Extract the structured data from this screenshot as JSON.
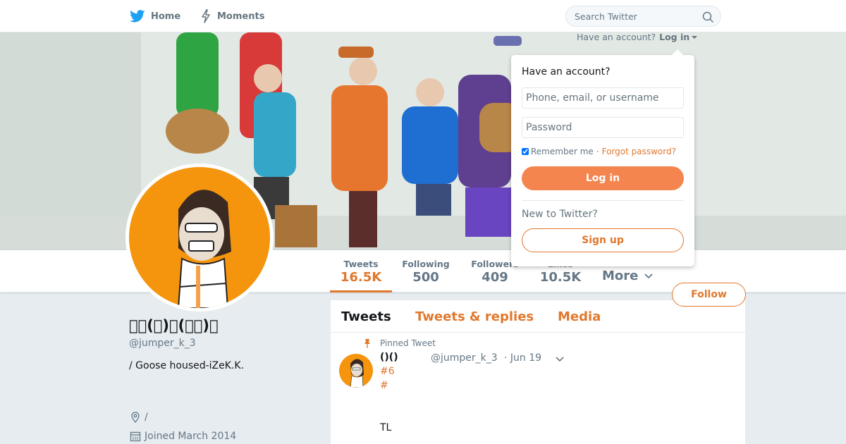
{
  "nav": {
    "home_label": "Home",
    "moments_label": "Moments",
    "search_placeholder": "Search Twitter"
  },
  "login_prompt": {
    "have_account": "Have an account?",
    "login_link": "Log in"
  },
  "login_dropdown": {
    "title": "Have an account?",
    "username_placeholder": "Phone, email, or username",
    "password_placeholder": "Password",
    "remember_label": "Remember me",
    "separator": "·",
    "forgot_label": "Forgot password?",
    "login_button": "Log in",
    "new_label": "New to Twitter?",
    "signup_button": "Sign up"
  },
  "stats": [
    {
      "label": "Tweets",
      "value": "16.5K"
    },
    {
      "label": "Following",
      "value": "500"
    },
    {
      "label": "Followers",
      "value": "409"
    },
    {
      "label": "Likes",
      "value": "10.5K"
    }
  ],
  "more_label": "More",
  "follow_button": "Follow",
  "profile": {
    "name": "\u0000\u0000(\u0000)\u0000(\u0000\u0000)\u0000",
    "handle": "@jumper_k_3",
    "bio": "/ Goose housed-iZeK.K.",
    "location": "/",
    "joined": "Joined March 2014"
  },
  "timeline": {
    "tabs": [
      "Tweets",
      "Tweets & replies",
      "Media"
    ],
    "pinned_label": "Pinned Tweet",
    "tweet": {
      "name": "()()",
      "handle": "@jumper_k_3",
      "date": "· Jun 19",
      "hashtag1": "#6",
      "hashtag2": "#",
      "text": "TL"
    }
  },
  "colors": {
    "accent": "#e0782d",
    "button_fill": "#f5854f",
    "avatar_bg": "#f5950e",
    "page_bg": "#e6ecf0"
  },
  "icons": [
    "twitter-bird-icon",
    "moments-bolt-icon",
    "search-icon",
    "chevron-down-icon",
    "pin-icon",
    "location-icon",
    "calendar-icon"
  ]
}
